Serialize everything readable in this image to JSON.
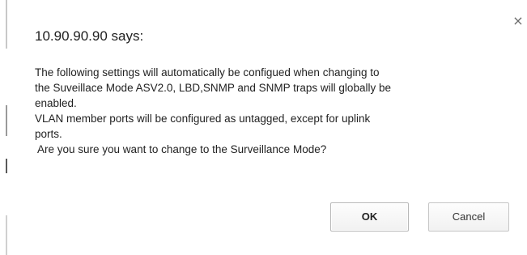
{
  "dialog": {
    "title": "10.90.90.90 says:",
    "close_glyph": "×",
    "message_lines": [
      "The following settings will automatically be configued when changing to",
      "the Suveillace Mode ASV2.0, LBD,SNMP and SNMP traps will globally be",
      "enabled.",
      "VLAN member ports will be configured as untagged, except for uplink",
      "ports.",
      " Are you sure you want to change to the Surveillance Mode?"
    ],
    "ok_label": "OK",
    "cancel_label": "Cancel"
  }
}
